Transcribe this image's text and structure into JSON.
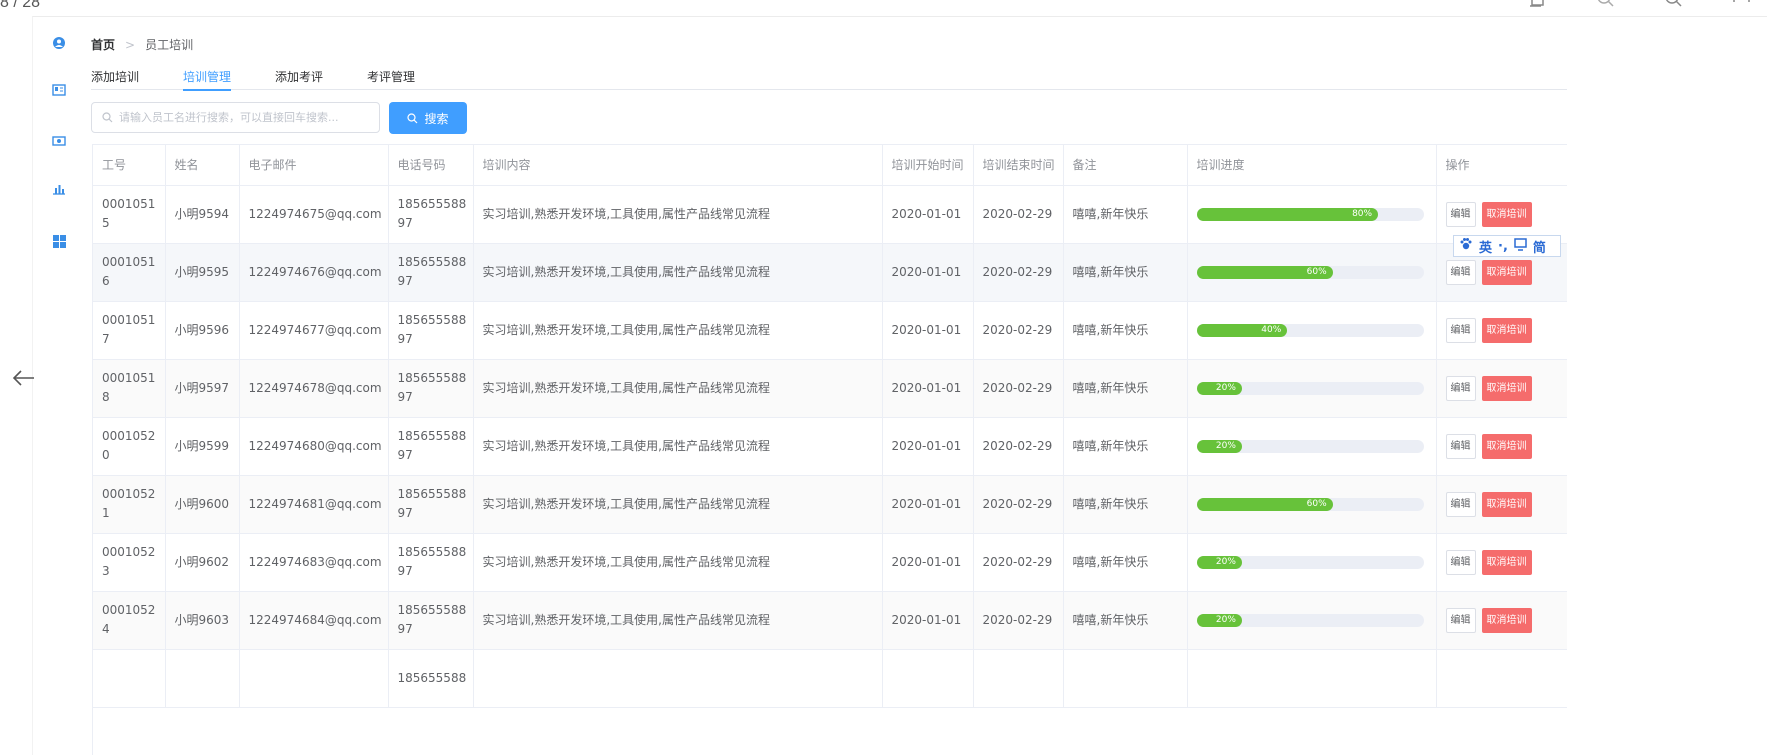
{
  "viewer": {
    "page_counter": "8 / 28"
  },
  "breadcrumb": {
    "home": "首页",
    "separator": ">",
    "current": "员工培训"
  },
  "tabs": [
    {
      "label": "添加培训",
      "active": false
    },
    {
      "label": "培训管理",
      "active": true
    },
    {
      "label": "添加考评",
      "active": false
    },
    {
      "label": "考评管理",
      "active": false
    }
  ],
  "search": {
    "placeholder": "请输入员工名进行搜索，可以直接回车搜索...",
    "button_label": "搜索"
  },
  "table": {
    "headers": {
      "id": "工号",
      "name": "姓名",
      "email": "电子邮件",
      "phone": "电话号码",
      "content": "培训内容",
      "start": "培训开始时间",
      "end": "培训结束时间",
      "remark": "备注",
      "progress": "培训进度",
      "actions": "操作"
    },
    "edit_label": "编辑",
    "cancel_label": "取消培训",
    "rows": [
      {
        "id": "00010515",
        "name": "小明9594",
        "email": "1224974675@qq.com",
        "phone": "18565558897",
        "content": "实习培训,熟悉开发环境,工具使用,属性产品线常见流程",
        "start": "2020-01-01",
        "end": "2020-02-29",
        "remark": "嘻嘻,新年快乐",
        "progress": 80,
        "progress_label": "80%"
      },
      {
        "id": "00010516",
        "name": "小明9595",
        "email": "1224974676@qq.com",
        "phone": "18565558897",
        "content": "实习培训,熟悉开发环境,工具使用,属性产品线常见流程",
        "start": "2020-01-01",
        "end": "2020-02-29",
        "remark": "嘻嘻,新年快乐",
        "progress": 60,
        "progress_label": "60%"
      },
      {
        "id": "00010517",
        "name": "小明9596",
        "email": "1224974677@qq.com",
        "phone": "18565558897",
        "content": "实习培训,熟悉开发环境,工具使用,属性产品线常见流程",
        "start": "2020-01-01",
        "end": "2020-02-29",
        "remark": "嘻嘻,新年快乐",
        "progress": 40,
        "progress_label": "40%"
      },
      {
        "id": "00010518",
        "name": "小明9597",
        "email": "1224974678@qq.com",
        "phone": "18565558897",
        "content": "实习培训,熟悉开发环境,工具使用,属性产品线常见流程",
        "start": "2020-01-01",
        "end": "2020-02-29",
        "remark": "嘻嘻,新年快乐",
        "progress": 20,
        "progress_label": "20%"
      },
      {
        "id": "00010520",
        "name": "小明9599",
        "email": "1224974680@qq.com",
        "phone": "18565558897",
        "content": "实习培训,熟悉开发环境,工具使用,属性产品线常见流程",
        "start": "2020-01-01",
        "end": "2020-02-29",
        "remark": "嘻嘻,新年快乐",
        "progress": 20,
        "progress_label": "20%"
      },
      {
        "id": "00010521",
        "name": "小明9600",
        "email": "1224974681@qq.com",
        "phone": "18565558897",
        "content": "实习培训,熟悉开发环境,工具使用,属性产品线常见流程",
        "start": "2020-01-01",
        "end": "2020-02-29",
        "remark": "嘻嘻,新年快乐",
        "progress": 60,
        "progress_label": "60%"
      },
      {
        "id": "00010523",
        "name": "小明9602",
        "email": "1224974683@qq.com",
        "phone": "18565558897",
        "content": "实习培训,熟悉开发环境,工具使用,属性产品线常见流程",
        "start": "2020-01-01",
        "end": "2020-02-29",
        "remark": "嘻嘻,新年快乐",
        "progress": 20,
        "progress_label": "20%"
      },
      {
        "id": "00010524",
        "name": "小明9603",
        "email": "1224974684@qq.com",
        "phone": "18565558897",
        "content": "实习培训,熟悉开发环境,工具使用,属性产品线常见流程",
        "start": "2020-01-01",
        "end": "2020-02-29",
        "remark": "嘻嘻,新年快乐",
        "progress": 20,
        "progress_label": "20%"
      },
      {
        "id": "",
        "name": "",
        "email": "",
        "phone": "185655588",
        "content": "",
        "start": "",
        "end": "",
        "remark": "",
        "progress": null,
        "progress_label": ""
      }
    ]
  },
  "ime_toolbar": {
    "mode_label": "英",
    "punct": "·,",
    "width_label": "简"
  },
  "colors": {
    "accent": "#409eff",
    "progress": "#67c23a",
    "danger": "#f56c6c"
  }
}
